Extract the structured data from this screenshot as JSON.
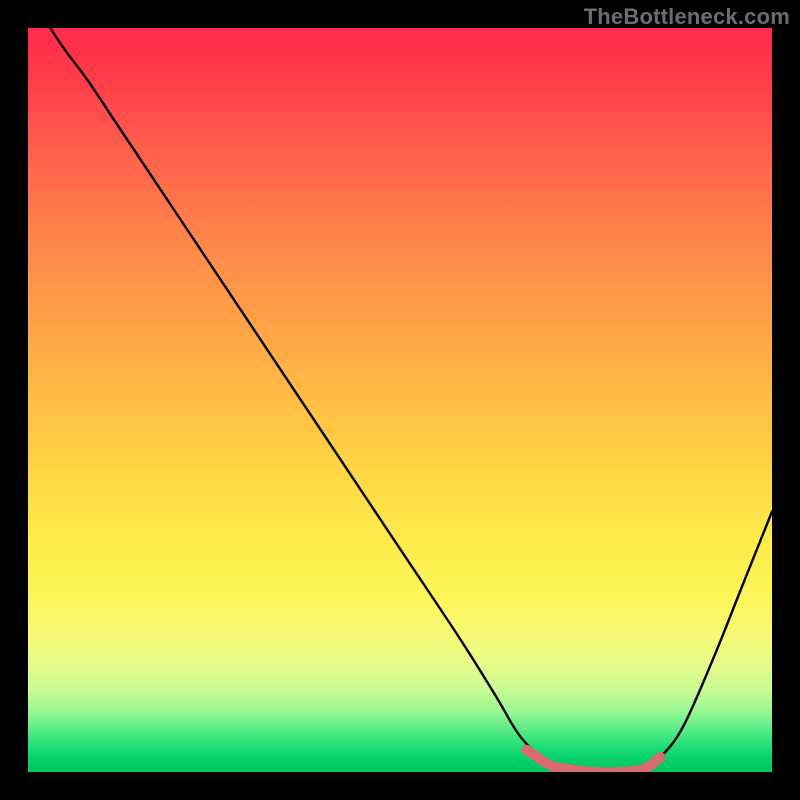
{
  "watermark": {
    "text": "TheBottleneck.com"
  },
  "colors": {
    "background": "#000000",
    "curve": "#000000",
    "accent": "#d96a6e",
    "gradient_top": "#ff2a4d",
    "gradient_bottom": "#00c861"
  },
  "chart_data": {
    "type": "line",
    "title": "",
    "xlabel": "",
    "ylabel": "",
    "xlim": [
      0,
      100
    ],
    "ylim": [
      0,
      100
    ],
    "grid": false,
    "legend": false,
    "series": [
      {
        "name": "bottleneck-curve",
        "points": [
          {
            "x": 3,
            "y": 100
          },
          {
            "x": 5,
            "y": 97
          },
          {
            "x": 8,
            "y": 93
          },
          {
            "x": 12,
            "y": 87
          },
          {
            "x": 20,
            "y": 75
          },
          {
            "x": 30,
            "y": 60
          },
          {
            "x": 40,
            "y": 45
          },
          {
            "x": 50,
            "y": 30
          },
          {
            "x": 58,
            "y": 18
          },
          {
            "x": 63,
            "y": 10
          },
          {
            "x": 66,
            "y": 5
          },
          {
            "x": 69,
            "y": 2
          },
          {
            "x": 72,
            "y": 0.5
          },
          {
            "x": 76,
            "y": 0
          },
          {
            "x": 80,
            "y": 0
          },
          {
            "x": 83,
            "y": 0.5
          },
          {
            "x": 85,
            "y": 2
          },
          {
            "x": 88,
            "y": 6
          },
          {
            "x": 92,
            "y": 15
          },
          {
            "x": 96,
            "y": 25
          },
          {
            "x": 100,
            "y": 35
          }
        ]
      },
      {
        "name": "optimal-range-accent",
        "points": [
          {
            "x": 67,
            "y": 3
          },
          {
            "x": 70,
            "y": 1
          },
          {
            "x": 72,
            "y": 0.5
          },
          {
            "x": 76,
            "y": 0
          },
          {
            "x": 80,
            "y": 0
          },
          {
            "x": 83,
            "y": 0.5
          },
          {
            "x": 85,
            "y": 2
          }
        ]
      }
    ],
    "annotations": []
  }
}
